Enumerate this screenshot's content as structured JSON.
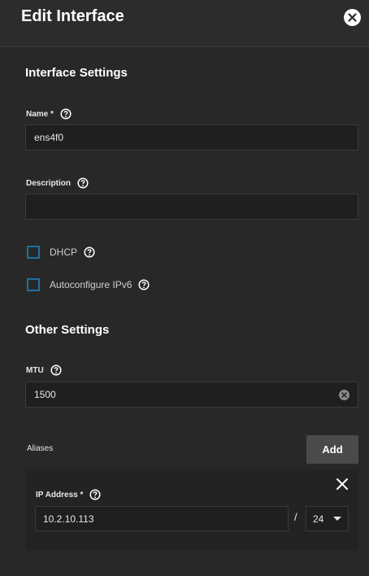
{
  "dialog": {
    "title": "Edit Interface",
    "close_icon": "close-circle-icon"
  },
  "interface_settings": {
    "section_title": "Interface Settings",
    "name_label": "Name *",
    "name_value": "ens4f0",
    "description_label": "Description",
    "description_value": "",
    "dhcp_label": "DHCP",
    "dhcp_checked": false,
    "autoconfigure_label": "Autoconfigure IPv6",
    "autoconfigure_checked": false
  },
  "other_settings": {
    "section_title": "Other Settings",
    "mtu_label": "MTU",
    "mtu_value": "1500"
  },
  "aliases": {
    "label": "Aliases",
    "add_label": "Add",
    "items": [
      {
        "ip_label": "IP Address *",
        "ip_value": "10.2.10.113",
        "separator": "/",
        "netmask_value": "24"
      }
    ]
  },
  "colors": {
    "background": "#282828",
    "input_background": "#1f1f1f",
    "checkbox_border": "#1e6fa3",
    "button_background": "#4a4a4a"
  }
}
